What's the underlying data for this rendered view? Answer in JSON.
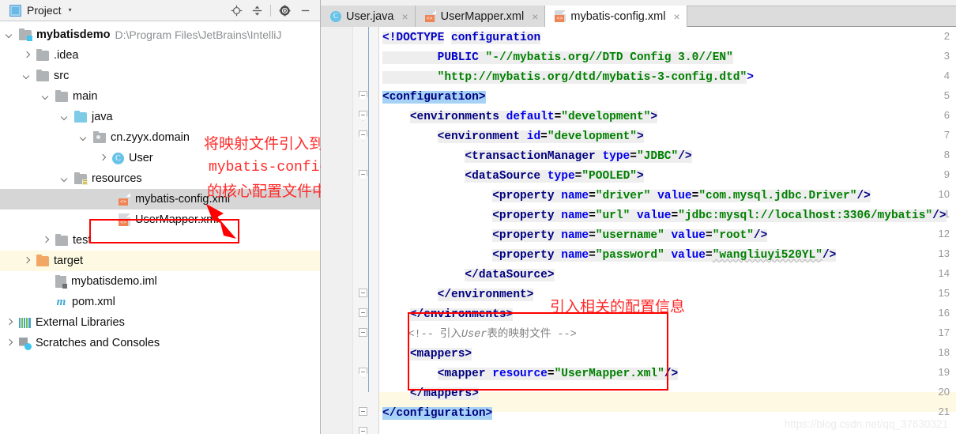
{
  "project_panel": {
    "header": {
      "title": "Project",
      "caret": "▾",
      "tools": [
        {
          "name": "locate-icon",
          "label": "⊕"
        },
        {
          "name": "collapse-all-icon",
          "label": "≣"
        },
        {
          "name": "settings-gear-icon",
          "label": "⚙"
        },
        {
          "name": "hide-panel-icon",
          "label": "—"
        }
      ]
    },
    "tree": [
      {
        "label": "mybatisdemo",
        "path": "D:\\Program Files\\JetBrains\\IntelliJ",
        "icon": "module-folder-icon",
        "arrow": "down",
        "indent": 1,
        "bold": true,
        "state": "none"
      },
      {
        "label": ".idea",
        "path": "",
        "icon": "folder-icon",
        "arrow": "right",
        "indent": 2,
        "bold": false,
        "state": "none"
      },
      {
        "label": "src",
        "path": "",
        "icon": "folder-icon",
        "arrow": "down",
        "indent": 2,
        "bold": false,
        "state": "none"
      },
      {
        "label": "main",
        "path": "",
        "icon": "folder-icon",
        "arrow": "down",
        "indent": 3,
        "bold": false,
        "state": "none"
      },
      {
        "label": "java",
        "path": "",
        "icon": "sources-folder-icon",
        "arrow": "down",
        "indent": 4,
        "bold": false,
        "state": "none"
      },
      {
        "label": "cn.zyyx.domain",
        "path": "",
        "icon": "package-icon",
        "arrow": "down",
        "indent": 5,
        "bold": false,
        "state": "none"
      },
      {
        "label": "User",
        "path": "",
        "icon": "java-class-icon",
        "arrow": "right",
        "indent": 6,
        "bold": false,
        "state": "none"
      },
      {
        "label": "resources",
        "path": "",
        "icon": "resources-folder-icon",
        "arrow": "down",
        "indent": 4,
        "bold": false,
        "state": "none"
      },
      {
        "label": "mybatis-config.xml",
        "path": "",
        "icon": "xml-file-icon",
        "arrow": "none",
        "indent": 7,
        "bold": false,
        "state": "selected-gray"
      },
      {
        "label": "UserMapper.xml",
        "path": "",
        "icon": "xml-file-icon",
        "arrow": "none",
        "indent": 7,
        "bold": false,
        "state": "none"
      },
      {
        "label": "test",
        "path": "",
        "icon": "folder-icon",
        "arrow": "right",
        "indent": 3,
        "bold": false,
        "state": "none"
      },
      {
        "label": "target",
        "path": "",
        "icon": "target-folder-icon",
        "arrow": "right",
        "indent": 2,
        "bold": false,
        "state": "highlight-yellow"
      },
      {
        "label": "mybatisdemo.iml",
        "path": "",
        "icon": "iml-file-icon",
        "arrow": "none",
        "indent": 3,
        "bold": false,
        "state": "none"
      },
      {
        "label": "pom.xml",
        "path": "",
        "icon": "maven-pom-icon",
        "arrow": "none",
        "indent": 3,
        "bold": false,
        "state": "none"
      },
      {
        "label": "External Libraries",
        "path": "",
        "icon": "external-libraries-icon",
        "arrow": "right",
        "indent": 1,
        "bold": false,
        "state": "none"
      },
      {
        "label": "Scratches and Consoles",
        "path": "",
        "icon": "scratches-icon",
        "arrow": "right",
        "indent": 1,
        "bold": false,
        "state": "none"
      }
    ]
  },
  "editor": {
    "tabs": [
      {
        "label": "User.java",
        "icon": "java-class-icon",
        "active": false,
        "close": "×"
      },
      {
        "label": "UserMapper.xml",
        "icon": "xml-file-icon",
        "active": false,
        "close": "×"
      },
      {
        "label": "mybatis-config.xml",
        "icon": "xml-file-icon",
        "active": true,
        "close": "×"
      }
    ],
    "line_numbers": [
      "2",
      "3",
      "4",
      "5",
      "6",
      "7",
      "8",
      "9",
      "10",
      "11",
      "12",
      "13",
      "14",
      "15",
      "16",
      "17",
      "18",
      "19",
      "20",
      "21"
    ],
    "code_lines": [
      {
        "n": "2",
        "text": "<!DOCTYPE configuration"
      },
      {
        "n": "3",
        "text": "        PUBLIC \"-//mybatis.org//DTD Config 3.0//EN\""
      },
      {
        "n": "4",
        "text": "        \"http://mybatis.org/dtd/mybatis-3-config.dtd\">"
      },
      {
        "n": "5",
        "text": "<configuration>"
      },
      {
        "n": "6",
        "text": "    <environments default=\"development\">"
      },
      {
        "n": "7",
        "text": "        <environment id=\"development\">"
      },
      {
        "n": "8",
        "text": "            <transactionManager type=\"JDBC\"/>"
      },
      {
        "n": "9",
        "text": "            <dataSource type=\"POOLED\">"
      },
      {
        "n": "10",
        "text": "                <property name=\"driver\" value=\"com.mysql.jdbc.Driver\"/>"
      },
      {
        "n": "11",
        "text": "                <property name=\"url\" value=\"jdbc:mysql://localhost:3306/mybatis\"/>"
      },
      {
        "n": "12",
        "text": "                <property name=\"username\" value=\"root\"/>"
      },
      {
        "n": "13",
        "text": "                <property name=\"password\" value=\"wangliuyi520YL\"/>"
      },
      {
        "n": "14",
        "text": "            </dataSource>"
      },
      {
        "n": "15",
        "text": "        </environment>"
      },
      {
        "n": "16",
        "text": "    </environments>"
      },
      {
        "n": "17",
        "text": "    <!-- 引入User表的映射文件 -->"
      },
      {
        "n": "18",
        "text": "    <mappers>"
      },
      {
        "n": "19",
        "text": "        <mapper resource=\"UserMapper.xml\"/>"
      },
      {
        "n": "20",
        "text": "    </mappers>"
      },
      {
        "n": "21",
        "text": "</configuration>"
      }
    ]
  },
  "annotations": {
    "tree_note_line1": "将映射文件引入到",
    "tree_note_line2": "mybatis-config.xml",
    "tree_note_line3": "的核心配置文件中",
    "editor_note": "引入相关的配置信息"
  },
  "watermark": "https://blog.csdn.net/qq_37630321"
}
